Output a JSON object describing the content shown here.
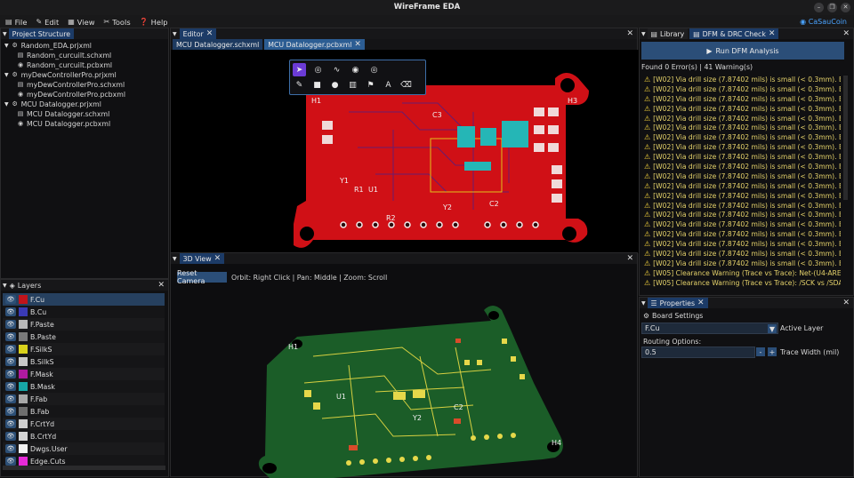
{
  "app": {
    "title": "WireFrame EDA",
    "user": "CaSauCoin"
  },
  "menu": [
    {
      "label": "File",
      "icon": "file-icon"
    },
    {
      "label": "Edit",
      "icon": "edit-icon"
    },
    {
      "label": "View",
      "icon": "view-icon"
    },
    {
      "label": "Tools",
      "icon": "tools-icon"
    },
    {
      "label": "Help",
      "icon": "help-icon"
    }
  ],
  "project": {
    "tab": "Project Structure",
    "tree": [
      {
        "label": "Random_EDA.prjxml",
        "level": 0,
        "type": "project"
      },
      {
        "label": "Random_curcuilt.schxml",
        "level": 1,
        "type": "schematic"
      },
      {
        "label": "Random_curcuilt.pcbxml",
        "level": 1,
        "type": "pcb"
      },
      {
        "label": "myDewControllerPro.prjxml",
        "level": 0,
        "type": "project"
      },
      {
        "label": "myDewControllerPro.schxml",
        "level": 1,
        "type": "schematic"
      },
      {
        "label": "myDewControllerPro.pcbxml",
        "level": 1,
        "type": "pcb"
      },
      {
        "label": "MCU Datalogger.prjxml",
        "level": 0,
        "type": "project"
      },
      {
        "label": "MCU Datalogger.schxml",
        "level": 1,
        "type": "schematic"
      },
      {
        "label": "MCU Datalogger.pcbxml",
        "level": 1,
        "type": "pcb"
      }
    ]
  },
  "layers": {
    "tab": "Layers",
    "items": [
      {
        "name": "F.Cu",
        "color": "#c0141b",
        "selected": true
      },
      {
        "name": "B.Cu",
        "color": "#3a3ab5"
      },
      {
        "name": "F.Paste",
        "color": "#b8b8b8"
      },
      {
        "name": "B.Paste",
        "color": "#7a7a7a"
      },
      {
        "name": "F.SilkS",
        "color": "#d9d21c"
      },
      {
        "name": "B.SilkS",
        "color": "#c8c8c8"
      },
      {
        "name": "F.Mask",
        "color": "#b01aa0"
      },
      {
        "name": "B.Mask",
        "color": "#17a6a6"
      },
      {
        "name": "F.Fab",
        "color": "#a8a8a8"
      },
      {
        "name": "B.Fab",
        "color": "#6e6e6e"
      },
      {
        "name": "F.CrtYd",
        "color": "#cfcfcf"
      },
      {
        "name": "B.CrtYd",
        "color": "#d4d4d4"
      },
      {
        "name": "Dwgs.User",
        "color": "#f2f2f2"
      },
      {
        "name": "Edge.Cuts",
        "color": "#e62ad8"
      }
    ]
  },
  "editor": {
    "tab": "Editor",
    "files": [
      "MCU Datalogger.schxml",
      "MCU Datalogger.pcbxml"
    ],
    "active_file": 1,
    "tools_row1": [
      "pointer-icon",
      "via-icon",
      "route-icon",
      "pad-icon",
      "target-icon"
    ],
    "tools_row2": [
      "pencil-icon",
      "rect-icon",
      "circle-icon",
      "zone-icon",
      "flag-icon",
      "text-icon",
      "eraser-icon"
    ],
    "text_tool": "A",
    "ref_labels": [
      "H1",
      "H3",
      "Y1",
      "R1",
      "U1",
      "R2",
      "Y2",
      "C2",
      "C3"
    ]
  },
  "view3d": {
    "tab": "3D View",
    "reset_label": "Reset Camera",
    "hint": "Orbit: Right Click | Pan: Middle | Zoom: Scroll",
    "ref_labels": [
      "H1",
      "H4",
      "C2",
      "Y2",
      "U1"
    ]
  },
  "library": {
    "tab": "Library"
  },
  "dfm": {
    "tab": "DFM & DRC Check",
    "run_label": "Run DFM Analysis",
    "summary": "Found 0 Error(s) | 41 Warning(s)",
    "warnings": [
      "[W02] Via drill size (7.87402 mils) is small (< 0.3mm). Ensure",
      "[W02] Via drill size (7.87402 mils) is small (< 0.3mm). Ensure",
      "[W02] Via drill size (7.87402 mils) is small (< 0.3mm). Ensure",
      "[W02] Via drill size (7.87402 mils) is small (< 0.3mm). Ensure",
      "[W02] Via drill size (7.87402 mils) is small (< 0.3mm). Ensure",
      "[W02] Via drill size (7.87402 mils) is small (< 0.3mm). Ensure",
      "[W02] Via drill size (7.87402 mils) is small (< 0.3mm). Ensure",
      "[W02] Via drill size (7.87402 mils) is small (< 0.3mm). Ensure",
      "[W02] Via drill size (7.87402 mils) is small (< 0.3mm). Ensure",
      "[W02] Via drill size (7.87402 mils) is small (< 0.3mm). Ensure",
      "[W02] Via drill size (7.87402 mils) is small (< 0.3mm). Ensure",
      "[W02] Via drill size (7.87402 mils) is small (< 0.3mm). Ensure",
      "[W02] Via drill size (7.87402 mils) is small (< 0.3mm). Ensure",
      "[W02] Via drill size (7.87402 mils) is small (< 0.3mm). Ensure",
      "[W02] Via drill size (7.87402 mils) is small (< 0.3mm). Ensure",
      "[W02] Via drill size (7.87402 mils) is small (< 0.3mm). Ensure",
      "[W02] Via drill size (7.87402 mils) is small (< 0.3mm). Ensure",
      "[W02] Via drill size (7.87402 mils) is small (< 0.3mm). Ensure",
      "[W02] Via drill size (7.87402 mils) is small (< 0.3mm). Ensure",
      "[W02] Via drill size (7.87402 mils) is small (< 0.3mm). Ensure",
      "[W05] Clearance Warning (Trace vs Trace): Net-(U4-AREF) vs",
      "[W05] Clearance Warning (Trace vs Trace): /SCK vs /SDA (Ga"
    ]
  },
  "properties": {
    "tab": "Properties",
    "section": "Board Settings",
    "layer_value": "F.Cu",
    "layer_label": "Active Layer",
    "routing_label": "Routing Options:",
    "width_value": "0.5",
    "width_label": "Trace Width (mil)"
  }
}
